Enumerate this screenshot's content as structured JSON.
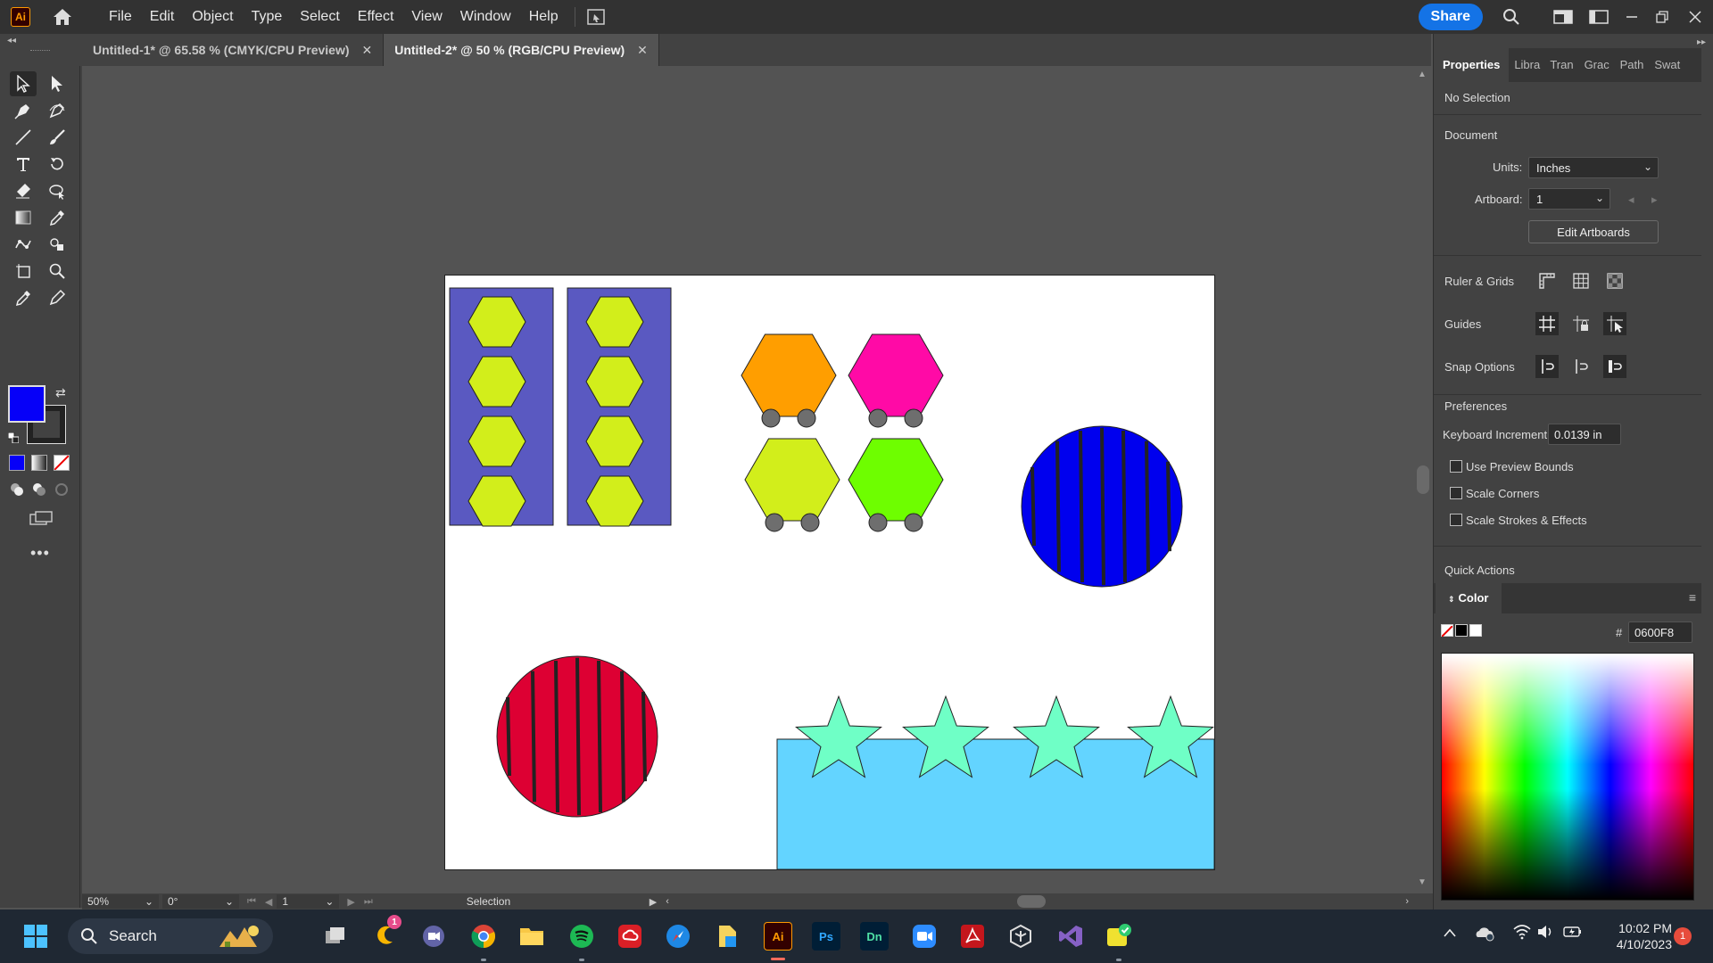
{
  "app": {
    "logo": "Ai"
  },
  "menu": [
    "File",
    "Edit",
    "Object",
    "Type",
    "Select",
    "Effect",
    "View",
    "Window",
    "Help"
  ],
  "share_label": "Share",
  "tabs": [
    {
      "label": "Untitled-1* @ 65.58 % (CMYK/CPU Preview)",
      "close": "✕"
    },
    {
      "label": "Untitled-2* @ 50 % (RGB/CPU Preview)",
      "close": "✕"
    }
  ],
  "colors": {
    "fill": "#0600f8",
    "stroke": "#222222",
    "accent": "#1473e6"
  },
  "canvas": {
    "rect_fill": "#5a59c1",
    "hex_yellow": "#d2ee1b",
    "hex_orange": "#ff9e00",
    "hex_magenta": "#ff0aa6",
    "hex_green": "#6efe00",
    "wheel_gray": "#6e6e6e",
    "circle_blue": "#0000ee",
    "circle_red": "#dd0033",
    "stripe": "#222222",
    "water": "#63d4ff",
    "star": "#6fffc6"
  },
  "status": {
    "zoom": "50%",
    "rotation": "0°",
    "artboard": "1",
    "tool": "Selection"
  },
  "panel": {
    "tabs": [
      "Properties",
      "Libra",
      "Tran",
      "Grac",
      "Path",
      "Swat"
    ],
    "selection": "No Selection",
    "document_heading": "Document",
    "units_label": "Units:",
    "units_value": "Inches",
    "artboard_label": "Artboard:",
    "artboard_value": "1",
    "edit_artboards": "Edit Artboards",
    "ruler_grids": "Ruler & Grids",
    "guides": "Guides",
    "snap_options": "Snap Options",
    "preferences": "Preferences",
    "keyboard_increment_label": "Keyboard Increment:",
    "keyboard_increment_value": "0.0139 in",
    "use_preview_bounds": "Use Preview Bounds",
    "scale_corners": "Scale Corners",
    "scale_strokes": "Scale Strokes & Effects",
    "quick_actions": "Quick Actions"
  },
  "color_panel": {
    "title": "Color",
    "hash": "#",
    "hex_value": "0600F8"
  },
  "taskbar": {
    "search": "Search",
    "apps": [
      "Ps",
      "Dn",
      "Ai"
    ],
    "time": "10:02 PM",
    "date": "4/10/2023",
    "badge": "1",
    "notifications": "1"
  }
}
